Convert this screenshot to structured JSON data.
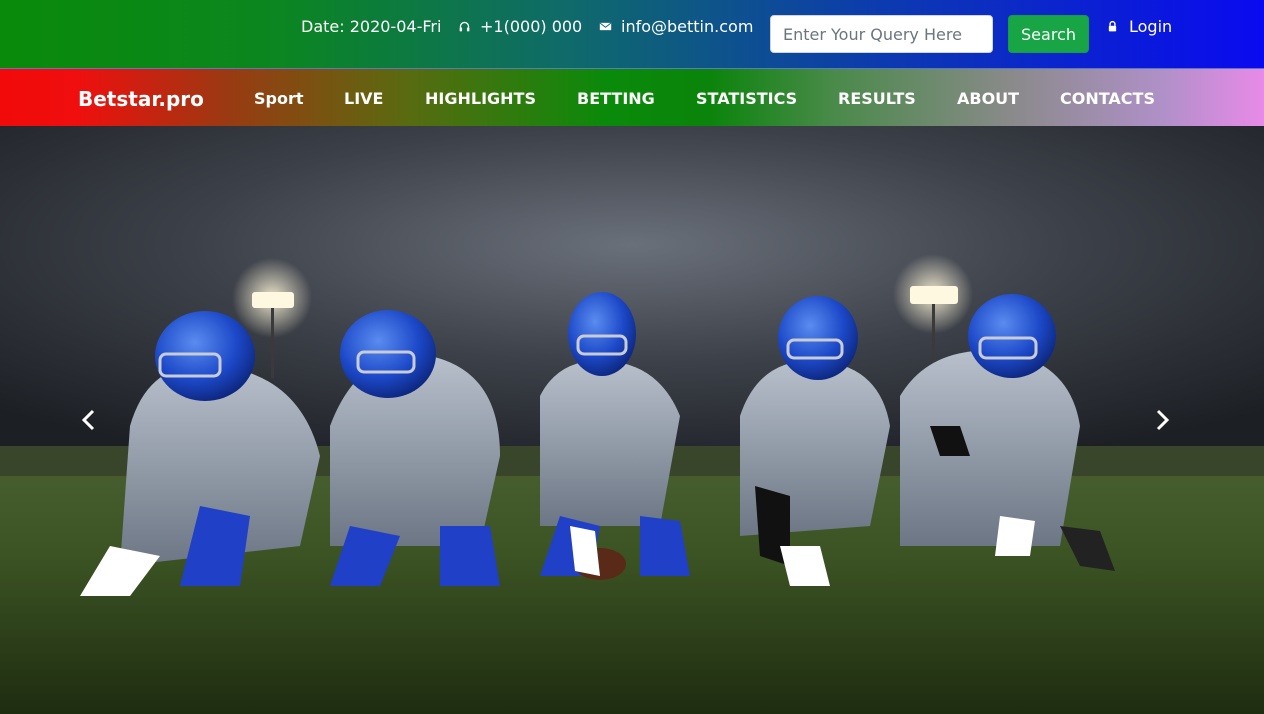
{
  "topbar": {
    "date_text": "Date: 2020-04-Fri",
    "phone_icon": "headset-icon",
    "phone_text": "+1(000) 000",
    "mail_icon": "envelope-icon",
    "email_text": "info@bettin.com",
    "search_placeholder": "Enter Your Query Here",
    "search_label": "Search",
    "login_icon": "lock-icon",
    "login_label": "Login"
  },
  "navbar": {
    "brand": "Betstar.pro",
    "links": [
      "Sport",
      "LIVE",
      "HIGHLIGHTS",
      "BETTING",
      "STATISTICS",
      "RESULTS",
      "ABOUT",
      "CONTACTS"
    ]
  },
  "hero": {
    "image": "football-linemen-at-dusk-photo",
    "prev_icon": "chevron-left-icon",
    "next_icon": "chevron-right-icon"
  },
  "colors": {
    "search_button": "#18a546",
    "brand_red": "#f20a0a",
    "top_green": "#0a8a0a",
    "top_blue": "#0a0af0"
  }
}
